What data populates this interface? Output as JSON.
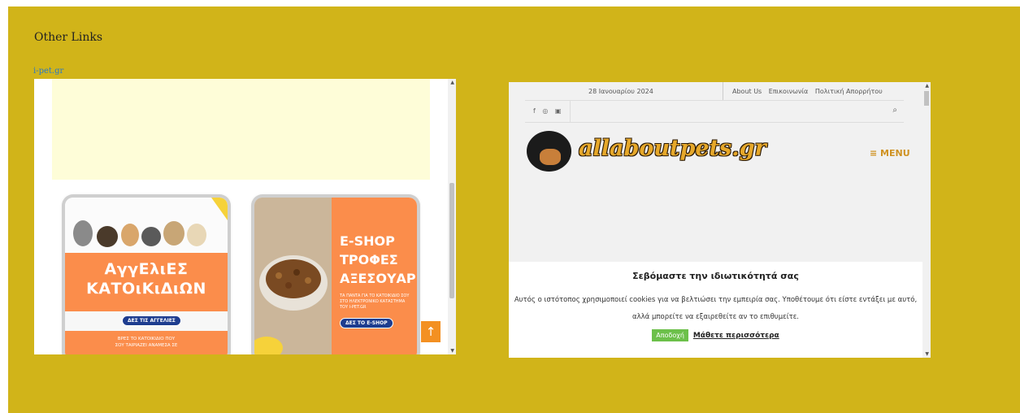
{
  "section": {
    "title": "Other Links",
    "link_text": "i-pet.gr"
  },
  "frame1": {
    "card1": {
      "heading_line1": "ΑγγΕλιΕΣ",
      "heading_line2": "ΚΑΤΟιΚιΔιΩΝ",
      "button": "ΔΕΣ ΤΙΣ ΑΓΓΕΛΙΕΣ",
      "bottom_text_1": "ΒΡΕΣ ΤΟ ΚΑΤΟΙΚΙΔΙΟ ΠΟΥ",
      "bottom_text_2": "ΣΟΥ ΤΑΙΡΙΑΖΕΙ ΑΝΑΜΕΣΑ ΣΕ"
    },
    "card2": {
      "heading_line1": "E-SHOP",
      "heading_line2": "ΤΡΟΦΕΣ",
      "heading_line3": "ΑΞΕΣΟΥΑΡ",
      "subtext": "ΤΑ ΠΑΝΤΑ ΓΙΑ ΤΟ ΚΑΤΟΙΚΙΔΙΟ ΣΟΥ ΣΤΟ ΗΛΕΚΤΡΟΝΙΚΟ ΚΑΤΑΣΤΗΜΑ ΤΟΥ I-PET.GR",
      "button": "ΔΕΣ ΤΟ E-SHOP"
    },
    "scroll_up_icon": "↑"
  },
  "frame2": {
    "date": "28 Ιανουαρίου 2024",
    "top_links": [
      "About Us",
      "Επικοινωνία",
      "Πολιτική Απορρήτου"
    ],
    "social_icons": "f ◎ ▣",
    "search_icon": "⌕",
    "logo_text": "allaboutpets.gr",
    "menu_label": "≡ MENU",
    "cookie": {
      "title": "Σεβόμαστε την ιδιωτικότητά σας",
      "text_line1": "Αυτός ο ιστότοπος χρησιμοποιεί cookies για να βελτιώσει την εμπειρία σας. Υποθέτουμε ότι είστε εντάξει με αυτό,",
      "text_line2": "αλλά μπορείτε να εξαιρεθείτε αν το επιθυμείτε.",
      "accept": "Αποδοχή",
      "more": "Μάθετε περισσότερα"
    }
  },
  "colors": {
    "panel_bg": "#d1b419",
    "link": "#2a78c4",
    "orange": "#fb8d4b",
    "accept_green": "#6cc04a"
  }
}
